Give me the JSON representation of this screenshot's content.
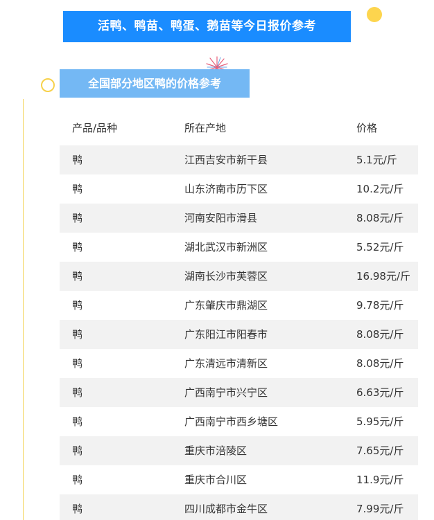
{
  "header": {
    "main_title": "活鸭、鸭苗、鸭蛋、鹅苗等今日报价参考",
    "section_title": "全国部分地区鸭的价格参考"
  },
  "colors": {
    "title_bg": "#1a8cff",
    "section_bg": "#74b8f4",
    "accent_yellow": "#fdd54e",
    "row_shade": "#f2f2f2"
  },
  "table": {
    "columns": [
      "产品/品种",
      "所在产地",
      "价格"
    ],
    "rows": [
      [
        "鸭",
        "江西吉安市新干县",
        "5.1元/斤"
      ],
      [
        "鸭",
        "山东济南市历下区",
        "10.2元/斤"
      ],
      [
        "鸭",
        "河南安阳市滑县",
        "8.08元/斤"
      ],
      [
        "鸭",
        "湖北武汉市新洲区",
        "5.52元/斤"
      ],
      [
        "鸭",
        "湖南长沙市芙蓉区",
        "16.98元/斤"
      ],
      [
        "鸭",
        "广东肇庆市鼎湖区",
        "9.78元/斤"
      ],
      [
        "鸭",
        "广东阳江市阳春市",
        "8.08元/斤"
      ],
      [
        "鸭",
        "广东清远市清新区",
        "8.08元/斤"
      ],
      [
        "鸭",
        "广西南宁市兴宁区",
        "6.63元/斤"
      ],
      [
        "鸭",
        "广西南宁市西乡塘区",
        "5.95元/斤"
      ],
      [
        "鸭",
        "重庆市涪陵区",
        "7.65元/斤"
      ],
      [
        "鸭",
        "重庆市合川区",
        "11.9元/斤"
      ],
      [
        "鸭",
        "四川成都市金牛区",
        "7.99元/斤"
      ]
    ]
  }
}
